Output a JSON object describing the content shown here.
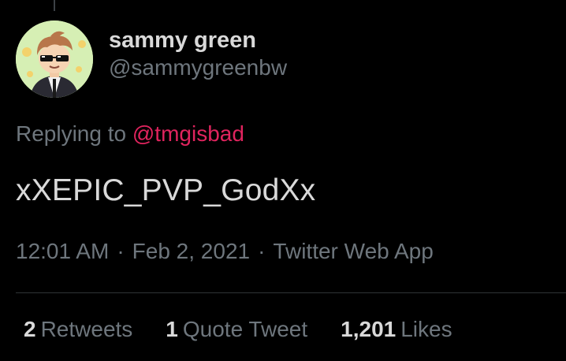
{
  "author": {
    "display_name": "sammy green",
    "handle": "@sammygreenbw",
    "avatar_icon": "cartoon-avatar-with-sunglasses"
  },
  "reply": {
    "prefix": "Replying to",
    "mention": "@tmgisbad"
  },
  "tweet": {
    "text": "xXEPIC_PVP_GodXx"
  },
  "meta": {
    "time": "12:01 AM",
    "separator": "·",
    "date": "Feb 2, 2021",
    "source": "Twitter Web App"
  },
  "stats": {
    "retweets": {
      "count": "2",
      "label": "Retweets"
    },
    "quotes": {
      "count": "1",
      "label": "Quote Tweet"
    },
    "likes": {
      "count": "1,201",
      "label": "Likes"
    }
  },
  "colors": {
    "background": "#000000",
    "text_primary": "#d9d9d9",
    "text_secondary": "#6e767d",
    "mention": "#e0245e",
    "divider": "#2f3336"
  }
}
